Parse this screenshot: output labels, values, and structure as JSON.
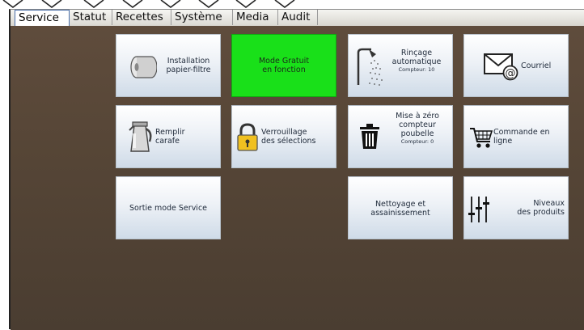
{
  "tabs": [
    {
      "label": "Service",
      "active": true
    },
    {
      "label": "Statut"
    },
    {
      "label": "Recettes"
    },
    {
      "label": "Système"
    },
    {
      "label": "Media"
    },
    {
      "label": "Audit"
    }
  ],
  "tiles": {
    "installation": {
      "line1": "Installation",
      "line2": "papier-filtre",
      "icon": "paper-roll-icon"
    },
    "mode_gratuit": {
      "line1": "Mode Gratuit",
      "line2": "en fonction",
      "color": "#19e019"
    },
    "rincage": {
      "line1": "Rinçage",
      "line2": "automatique",
      "counter": "Compteur: 10",
      "icon": "shower-icon"
    },
    "courriel": {
      "label": "Courriel",
      "icon": "email-icon"
    },
    "remplir": {
      "line1": "Remplir",
      "line2": "carafe",
      "icon": "kettle-icon"
    },
    "verrouillage": {
      "line1": "Verrouillage",
      "line2": "des sélections",
      "icon": "lock-icon"
    },
    "poubelle": {
      "line1": "Mise à zéro",
      "line2": "compteur",
      "line3": "poubelle",
      "counter": "Compteur: 0",
      "icon": "trash-icon"
    },
    "commande": {
      "line1": "Commande en",
      "line2": "ligne",
      "icon": "cart-icon"
    },
    "sortie": {
      "label": "Sortie mode Service"
    },
    "nettoyage": {
      "line1": "Nettoyage et",
      "line2": "assainissement"
    },
    "niveaux": {
      "line1": "Niveaux",
      "line2": "des produits",
      "icon": "sliders-icon"
    }
  }
}
